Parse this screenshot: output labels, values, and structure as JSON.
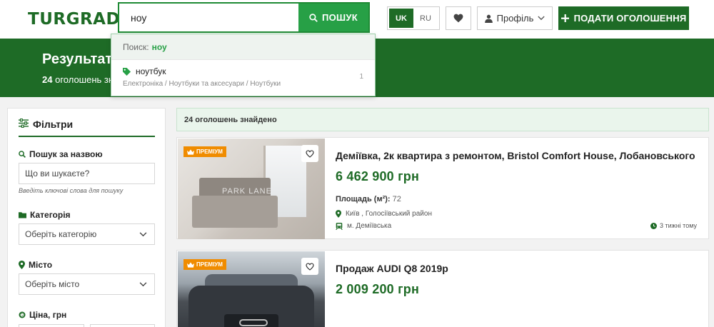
{
  "header": {
    "logo": "TURGRAD",
    "search_value": "ноу",
    "search_button": "ПОШУК",
    "lang_uk": "UK",
    "lang_ru": "RU",
    "profile_label": "Профіль",
    "post_button": "ПОДАТИ ОГОЛОШЕННЯ"
  },
  "banner": {
    "title": "Результати пошуку",
    "count": "24",
    "subtitle_rest": "оголошень знайдено"
  },
  "suggestions": {
    "head_label": "Поиск:",
    "head_query": "ноу",
    "items": [
      {
        "title": "ноутбук",
        "path": "Електроніка / Ноутбуки та аксесуари / Ноутбуки",
        "count": "1"
      }
    ]
  },
  "sidebar": {
    "title": "Фільтри",
    "search_label": "Пошук за назвою",
    "search_placeholder": "Що ви шукаєте?",
    "search_hint": "Введіть ключові слова для пошуку",
    "category_label": "Категорія",
    "category_value": "Оберіть категорію",
    "city_label": "Місто",
    "city_value": "Оберіть місто",
    "price_label": "Ціна, грн"
  },
  "results": {
    "found_text": "24 оголошень знайдено",
    "listings": [
      {
        "badge": "ПРЕМІУМ",
        "title": "Деміївка, 2к квартира з ремонтом, Bristol Comfort House, Лобановського",
        "price": "6 462 900 грн",
        "area_label": "Площадь (м²):",
        "area_value": "72",
        "location": "Київ , Голосіївський район",
        "metro": "м. Деміївська",
        "time": "3 тижні тому",
        "watermark": "PARK LANE"
      },
      {
        "badge": "ПРЕМІУМ",
        "title": "Продаж AUDI Q8 2019р",
        "price": "2 009 200 грн"
      }
    ]
  },
  "colors": {
    "brand_dark": "#1e6b26",
    "brand_green": "#27a046",
    "premium": "#f08c00"
  }
}
